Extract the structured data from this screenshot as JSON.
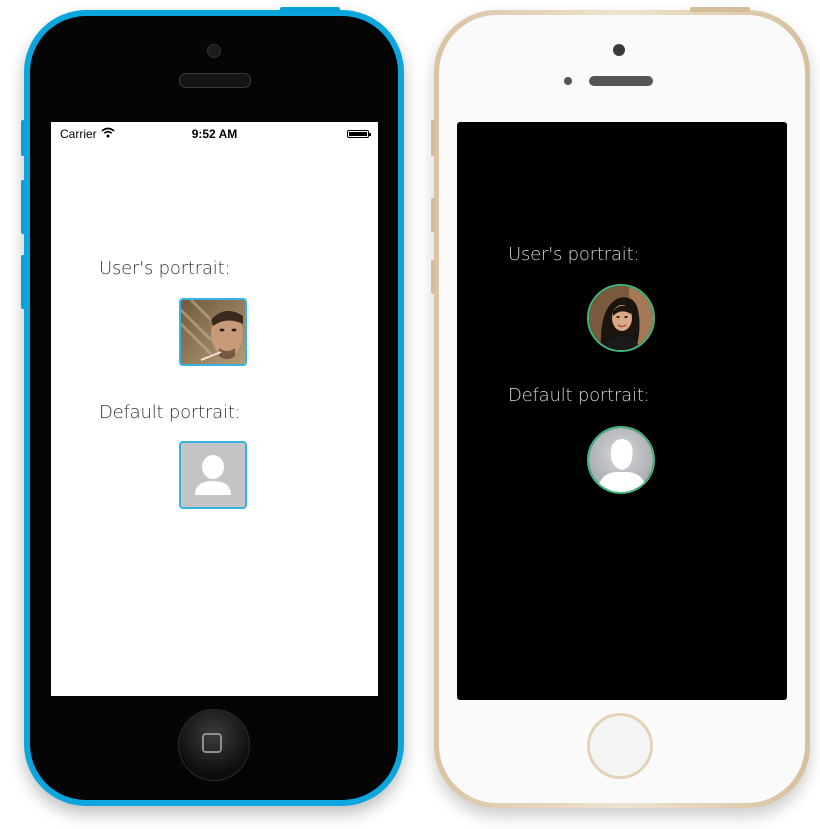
{
  "left_phone": {
    "status_bar": {
      "carrier": "Carrier",
      "time": "9:52 AM"
    },
    "user_portrait_label": "User's portrait:",
    "default_portrait_label": "Default portrait:",
    "portrait_style": "square",
    "accent_color": "#35b3e2"
  },
  "right_phone": {
    "user_portrait_label": "User's portrait:",
    "default_portrait_label": "Default portrait:",
    "portrait_style": "circle",
    "accent_color": "#3fb77d"
  },
  "icons": {
    "wifi": "wifi-icon",
    "battery": "battery-icon",
    "home": "home-button-icon",
    "default_avatar": "person-silhouette-icon"
  }
}
